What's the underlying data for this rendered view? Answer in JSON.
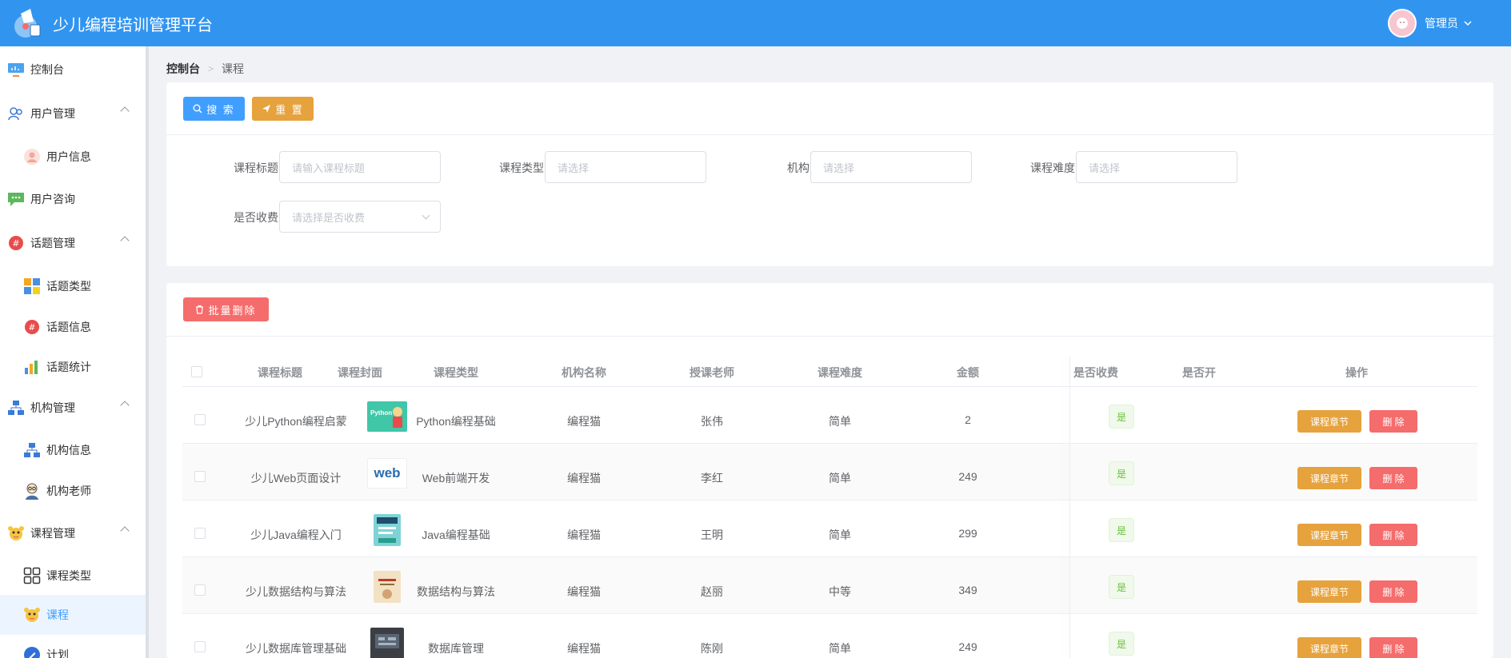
{
  "header": {
    "title": "少儿编程培训管理平台",
    "user": "管理员"
  },
  "sidebar": {
    "items": [
      {
        "label": "控制台",
        "level": "top",
        "icon": "dashboard-icon"
      },
      {
        "label": "用户管理",
        "level": "top",
        "icon": "users-icon",
        "expanded": true
      },
      {
        "label": "用户信息",
        "level": "sub",
        "icon": "user-avatar-icon"
      },
      {
        "label": "用户咨询",
        "level": "top",
        "icon": "chat-icon"
      },
      {
        "label": "话题管理",
        "level": "top",
        "icon": "topic-icon",
        "expanded": true
      },
      {
        "label": "话题类型",
        "level": "sub",
        "icon": "topic-type-icon"
      },
      {
        "label": "话题信息",
        "level": "sub",
        "icon": "topic-info-icon"
      },
      {
        "label": "话题统计",
        "level": "sub",
        "icon": "stats-icon"
      },
      {
        "label": "机构管理",
        "level": "top",
        "icon": "org-icon",
        "expanded": true
      },
      {
        "label": "机构信息",
        "level": "sub",
        "icon": "org-info-icon"
      },
      {
        "label": "机构老师",
        "level": "sub",
        "icon": "teacher-icon"
      },
      {
        "label": "课程管理",
        "level": "top",
        "icon": "course-mgmt-icon",
        "expanded": true
      },
      {
        "label": "课程类型",
        "level": "sub",
        "icon": "grid-icon"
      },
      {
        "label": "课程",
        "level": "sub",
        "icon": "course-icon",
        "active": true
      },
      {
        "label": "计划",
        "level": "sub",
        "icon": "plan-icon"
      }
    ]
  },
  "breadcrumb": {
    "root": "控制台",
    "current": "课程"
  },
  "search": {
    "search_label": "搜 索",
    "reset_label": "重 置",
    "fields": [
      {
        "label": "课程标题",
        "placeholder": "请输入课程标题"
      },
      {
        "label": "课程类型",
        "placeholder": "请选择"
      },
      {
        "label": "机构",
        "placeholder": "请选择"
      },
      {
        "label": "课程难度",
        "placeholder": "请选择"
      },
      {
        "label": "是否收费",
        "placeholder": "请选择是否收费"
      }
    ]
  },
  "table": {
    "batch_delete_label": "批量删除",
    "columns": [
      "课程标题",
      "课程封面",
      "课程类型",
      "机构名称",
      "授课老师",
      "课程难度",
      "金额",
      "是否收费",
      "是否开",
      "操作"
    ],
    "chapter_label": "课程章节",
    "delete_label": "删 除",
    "rows": [
      {
        "title": "少儿Python编程启蒙",
        "cover": "Python",
        "type": "Python编程基础",
        "org": "编程猫",
        "teacher": "张伟",
        "difficulty": "简单",
        "amount": "2",
        "paid": "是"
      },
      {
        "title": "少儿Web页面设计",
        "cover": "web",
        "type": "Web前端开发",
        "org": "编程猫",
        "teacher": "李红",
        "difficulty": "简单",
        "amount": "249",
        "paid": "是"
      },
      {
        "title": "少儿Java编程入门",
        "cover": "",
        "type": "Java编程基础",
        "org": "编程猫",
        "teacher": "王明",
        "difficulty": "简单",
        "amount": "299",
        "paid": "是"
      },
      {
        "title": "少儿数据结构与算法",
        "cover": "",
        "type": "数据结构与算法",
        "org": "编程猫",
        "teacher": "赵丽",
        "difficulty": "中等",
        "amount": "349",
        "paid": "是"
      },
      {
        "title": "少儿数据库管理基础",
        "cover": "",
        "type": "数据库管理",
        "org": "编程猫",
        "teacher": "陈刚",
        "difficulty": "简单",
        "amount": "249",
        "paid": "是"
      }
    ]
  },
  "colors": {
    "header": "#3195f0",
    "primary": "#409eff",
    "warning": "#e6a23c",
    "danger": "#f56c6c",
    "success": "#67c23a"
  }
}
